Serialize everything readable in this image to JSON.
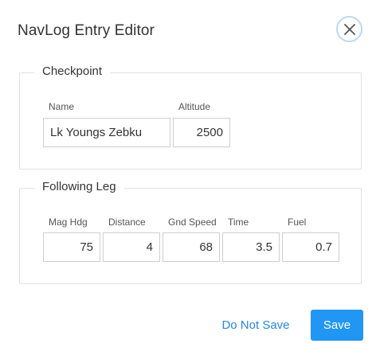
{
  "dialog": {
    "title": "NavLog Entry Editor",
    "close_icon": "close-icon",
    "accent_color": "#2196f3",
    "link_color": "#2b86d4"
  },
  "checkpoint": {
    "legend": "Checkpoint",
    "name_label": "Name",
    "name_value": "Lk Youngs Zebku",
    "altitude_label": "Altitude",
    "altitude_value": "2500"
  },
  "leg": {
    "legend": "Following Leg",
    "mag_hdg_label": "Mag Hdg",
    "mag_hdg_value": "75",
    "distance_label": "Distance",
    "distance_value": "4",
    "gnd_speed_label": "Gnd Speed",
    "gnd_speed_value": "68",
    "time_label": "Time",
    "time_value": "3.5",
    "fuel_label": "Fuel",
    "fuel_value": "0.7"
  },
  "actions": {
    "cancel_label": "Do Not Save",
    "save_label": "Save"
  }
}
